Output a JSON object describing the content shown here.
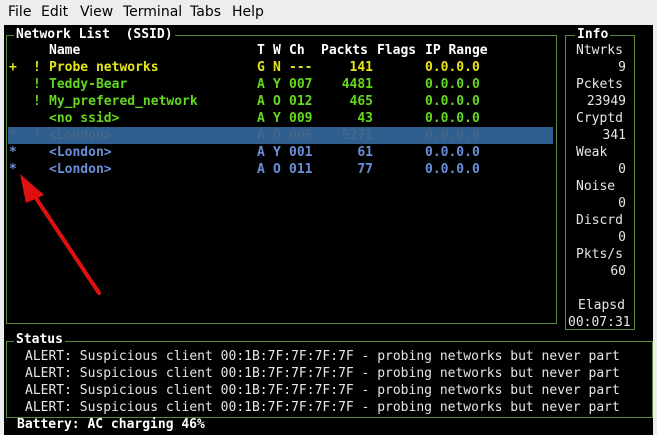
{
  "menu": [
    "File",
    "Edit",
    "View",
    "Terminal",
    "Tabs",
    "Help"
  ],
  "network_list": {
    "title": "Network List  (SSID)",
    "headers": {
      "name": "Name",
      "t": "T",
      "w": "W",
      "ch": "Ch",
      "packets": "Packts",
      "flags": "Flags",
      "ip": "IP Range"
    },
    "rows": [
      {
        "marker": "+",
        "flag": "!",
        "name": "Probe networks",
        "t": "G",
        "w": "N",
        "ch": "---",
        "packets": "141",
        "ip": "0.0.0.0",
        "style": "yellow"
      },
      {
        "marker": "",
        "flag": "!",
        "name": "Teddy-Bear",
        "t": "A",
        "w": "Y",
        "ch": "007",
        "packets": "4481",
        "ip": "0.0.0.0",
        "style": "green"
      },
      {
        "marker": "",
        "flag": "!",
        "name": "My_prefered_network",
        "t": "A",
        "w": "O",
        "ch": "012",
        "packets": "465",
        "ip": "0.0.0.0",
        "style": "green"
      },
      {
        "marker": "",
        "flag": "",
        "name": "<no ssid>",
        "t": "A",
        "w": "Y",
        "ch": "009",
        "packets": "43",
        "ip": "0.0.0.0",
        "style": "green"
      },
      {
        "marker": "*",
        "flag": "!",
        "name": "<London>",
        "t": "A",
        "w": "O",
        "ch": "006",
        "packets": "5271",
        "ip": "0.0.0.0",
        "style": "selected"
      },
      {
        "marker": "*",
        "flag": "",
        "name": "<London>",
        "t": "A",
        "w": "Y",
        "ch": "001",
        "packets": "61",
        "ip": "0.0.0.0",
        "style": "blue"
      },
      {
        "marker": "*",
        "flag": "",
        "name": "<London>",
        "t": "A",
        "w": "O",
        "ch": "011",
        "packets": "77",
        "ip": "0.0.0.0",
        "style": "blue"
      }
    ]
  },
  "info": {
    "title": "Info",
    "items": [
      {
        "label": "Ntwrks",
        "value": "9"
      },
      {
        "label": "Pckets",
        "value": "23949"
      },
      {
        "label": "Cryptd",
        "value": "341"
      },
      {
        "label": "Weak",
        "value": "0"
      },
      {
        "label": "Noise",
        "value": "0"
      },
      {
        "label": "Discrd",
        "value": "0"
      },
      {
        "label": "Pkts/s",
        "value": "60"
      }
    ],
    "elapsed_label": "Elapsd",
    "elapsed_value": "00:07:31"
  },
  "status": {
    "title": "Status",
    "lines": [
      "ALERT: Suspicious client 00:1B:7F:7F:7F:7F - probing networks but never part",
      "ALERT: Suspicious client 00:1B:7F:7F:7F:7F - probing networks but never part",
      "ALERT: Suspicious client 00:1B:7F:7F:7F:7F - probing networks but never part",
      "ALERT: Suspicious client 00:1B:7F:7F:7F:7F - probing networks but never part"
    ]
  },
  "battery": "Battery: AC charging 46%",
  "colors": {
    "accent_arrow": "#e01010",
    "selection": "#2f5f8f",
    "border": "#5c8a3a"
  }
}
